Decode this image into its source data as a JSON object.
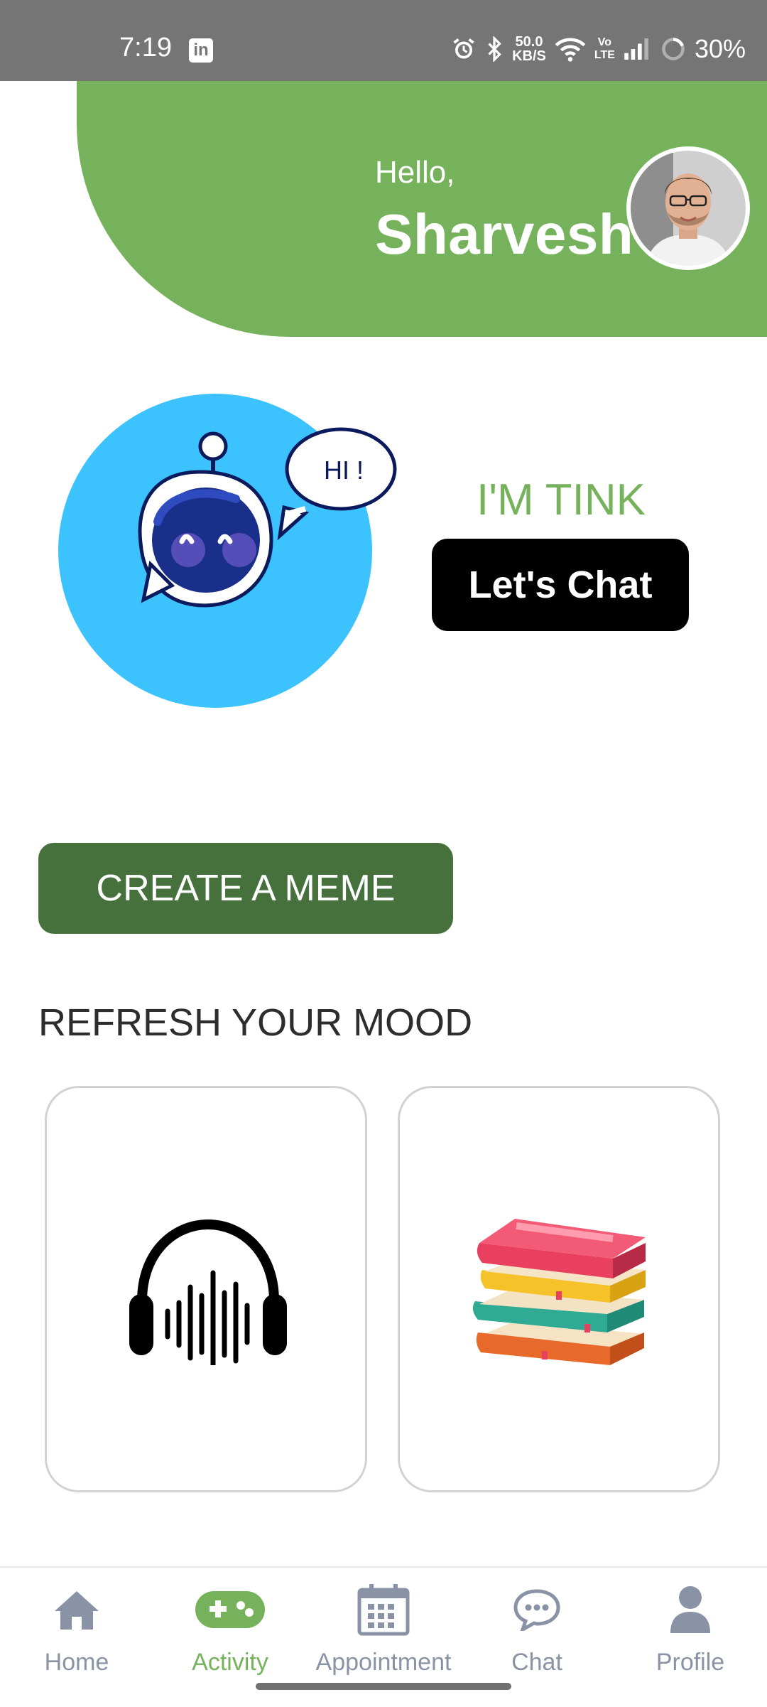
{
  "status_bar": {
    "time": "7:19",
    "app_icon": "linkedin-icon",
    "speed_value": "50.0",
    "speed_unit": "KB/S",
    "network_label_top": "Vo",
    "network_label_bottom": "LTE",
    "battery": "30%"
  },
  "header": {
    "greeting": "Hello,",
    "username": "Sharvesh",
    "bg_color": "#76b25b"
  },
  "bot": {
    "speech": "HI !",
    "name": "I'M TINK",
    "chat_button": "Let's Chat"
  },
  "meme_button": "CREATE A MEME",
  "mood": {
    "title": "REFRESH YOUR MOOD",
    "cards": [
      {
        "icon": "headphones-icon"
      },
      {
        "icon": "books-icon"
      }
    ]
  },
  "nav": {
    "items": [
      {
        "label": "Home",
        "icon": "home-icon"
      },
      {
        "label": "Activity",
        "icon": "gamepad-icon",
        "active": true
      },
      {
        "label": "Appointment",
        "icon": "calendar-icon"
      },
      {
        "label": "Chat",
        "icon": "chat-bubble-icon"
      },
      {
        "label": "Profile",
        "icon": "user-icon"
      }
    ],
    "active_color": "#76b25b",
    "inactive_color": "#8a93a6"
  }
}
